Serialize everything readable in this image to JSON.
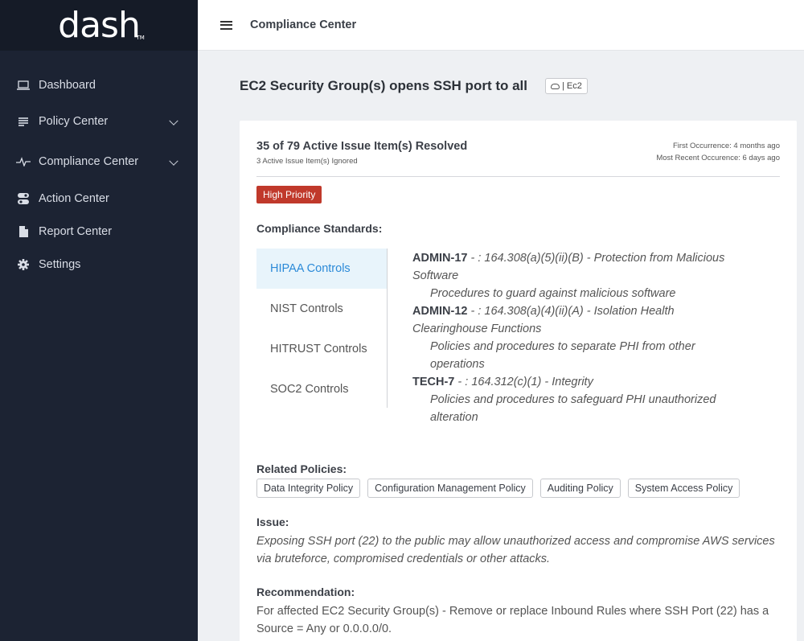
{
  "brand": {
    "logo": "dash",
    "tm": "TM"
  },
  "sidebar": {
    "items": [
      {
        "label": "Dashboard",
        "icon": "laptop-icon",
        "has_chevron": false
      },
      {
        "label": "Policy Center",
        "icon": "list-icon",
        "has_chevron": true
      },
      {
        "label": "Compliance Center",
        "icon": "pulse-icon",
        "has_chevron": true
      },
      {
        "label": "Action Center",
        "icon": "toggles-icon",
        "has_chevron": false
      },
      {
        "label": "Report Center",
        "icon": "file-icon",
        "has_chevron": false
      },
      {
        "label": "Settings",
        "icon": "gear-icon",
        "has_chevron": false
      }
    ]
  },
  "topbar": {
    "title": "Compliance Center"
  },
  "page": {
    "title": "EC2 Security Group(s) opens SSH port to all",
    "tag": "| Ec2"
  },
  "issue_card": {
    "resolved": "35 of 79 Active Issue Item(s) Resolved",
    "ignored": "3 Active Issue Item(s) Ignored",
    "first_occurrence": "First Occurrence: 4 months ago",
    "recent_occurrence": "Most Recent Occurence: 6 days ago",
    "priority": "High Priority",
    "priority_color": "#c0392b",
    "standards_label": "Compliance Standards:",
    "tabs": [
      "HIPAA Controls",
      "NIST Controls",
      "HITRUST Controls",
      "SOC2 Controls"
    ],
    "active_tab": "HIPAA Controls",
    "controls": [
      {
        "code": "ADMIN-17",
        "title": " - : 164.308(a)(5)(ii)(B) - Protection from Malicious Software",
        "desc": "Procedures to guard against malicious software"
      },
      {
        "code": "ADMIN-12",
        "title": " - : 164.308(a)(4)(ii)(A) - Isolation Health Clearinghouse Functions",
        "desc": "Policies and procedures to separate PHI from other operations"
      },
      {
        "code": "TECH-7",
        "title": " - : 164.312(c)(1) - Integrity",
        "desc": "Policies and procedures to safeguard PHI unauthorized alteration"
      }
    ],
    "related_label": "Related Policies:",
    "related_policies": [
      "Data Integrity Policy",
      "Configuration Management Policy",
      "Auditing Policy",
      "System Access Policy"
    ],
    "issue_label": "Issue:",
    "issue_text": "Exposing SSH port (22) to the public may allow unauthorized access and compromise AWS services via bruteforce, compromised credentials or other attacks.",
    "recommendation_label": "Recommendation:",
    "recommendation_text": "For affected EC2 Security Group(s) - Remove or replace Inbound Rules where SSH Port (22) has a Source = Any or 0.0.0.0/0."
  },
  "colors": {
    "sidebar_bg": "#1c2333",
    "accent": "#2b8ad8",
    "page_bg": "#eef0f3"
  }
}
